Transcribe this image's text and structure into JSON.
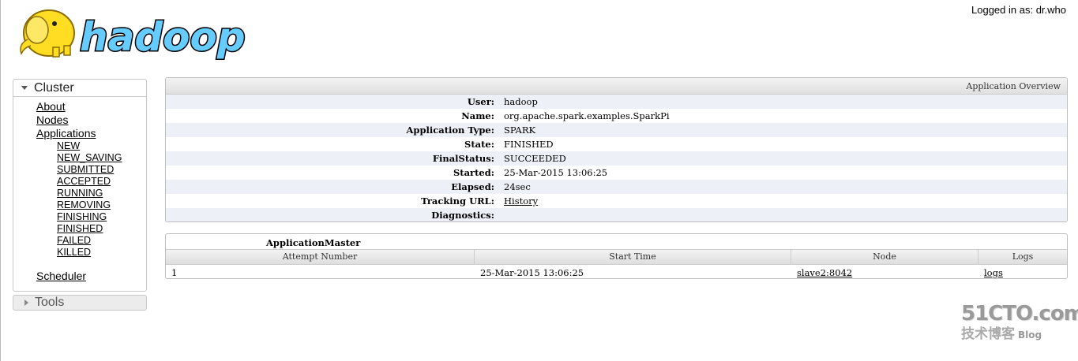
{
  "header": {
    "logo_text": "hadoop",
    "logged_in": "Logged in as: dr.who"
  },
  "nav": {
    "cluster_label": "Cluster",
    "links": [
      "About",
      "Nodes",
      "Applications"
    ],
    "app_states": [
      "NEW",
      "NEW_SAVING",
      "SUBMITTED",
      "ACCEPTED",
      "RUNNING",
      "REMOVING",
      "FINISHING",
      "FINISHED",
      "FAILED",
      "KILLED"
    ],
    "scheduler": "Scheduler",
    "tools_label": "Tools"
  },
  "overview": {
    "title": "Application Overview",
    "rows": [
      {
        "key": "User:",
        "value": "hadoop"
      },
      {
        "key": "Name:",
        "value": "org.apache.spark.examples.SparkPi"
      },
      {
        "key": "Application Type:",
        "value": "SPARK"
      },
      {
        "key": "State:",
        "value": "FINISHED"
      },
      {
        "key": "FinalStatus:",
        "value": "SUCCEEDED"
      },
      {
        "key": "Started:",
        "value": "25-Mar-2015 13:06:25"
      },
      {
        "key": "Elapsed:",
        "value": "24sec"
      },
      {
        "key": "Tracking URL:",
        "value": "History"
      },
      {
        "key": "Diagnostics:",
        "value": ""
      }
    ]
  },
  "attempts": {
    "title": "ApplicationMaster",
    "columns": [
      "Attempt Number",
      "Start Time",
      "Node",
      "Logs"
    ],
    "row": {
      "attempt": "1",
      "start": "25-Mar-2015 13:06:25",
      "node": "slave2:8042",
      "logs": "logs"
    }
  },
  "watermark": {
    "site": "51CTO.com",
    "sub": "技术博客",
    "blog": "Blog"
  }
}
